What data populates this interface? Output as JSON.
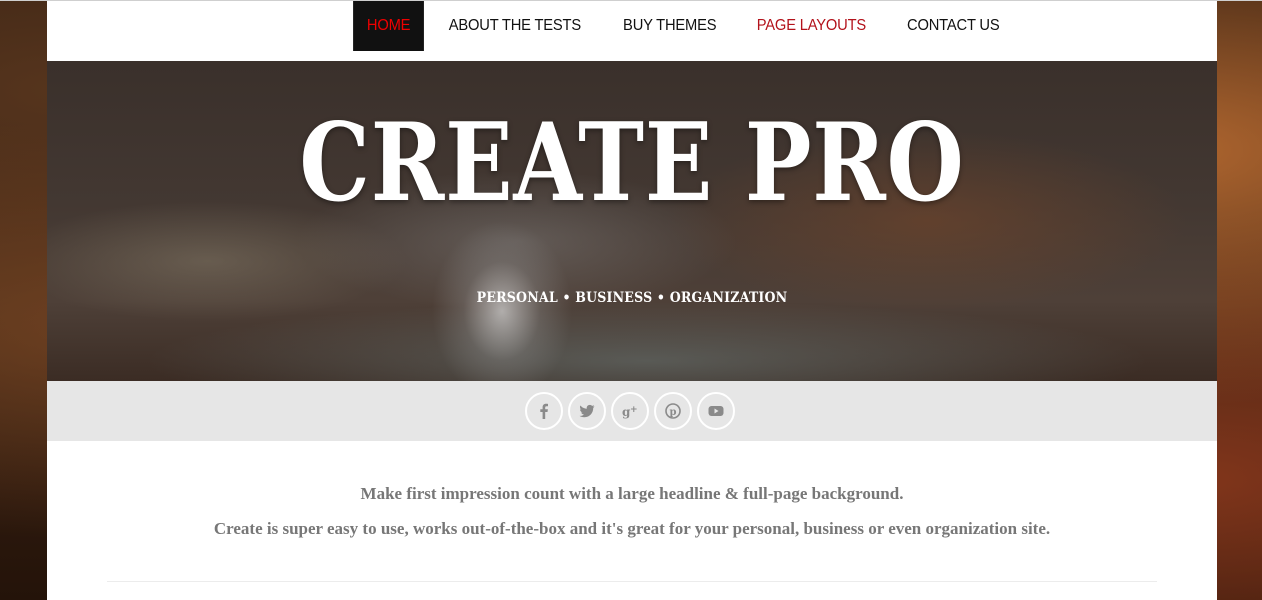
{
  "nav": {
    "items": [
      {
        "label": "HOME"
      },
      {
        "label": "ABOUT THE TESTS"
      },
      {
        "label": "BUY THEMES"
      },
      {
        "label": "PAGE LAYOUTS"
      },
      {
        "label": "CONTACT US"
      }
    ],
    "active_index": 0
  },
  "hero": {
    "title": "CREATE PRO",
    "subtitle": "PERSONAL • BUSINESS • ORGANIZATION"
  },
  "social": {
    "icons": [
      "facebook-icon",
      "twitter-icon",
      "google-plus-icon",
      "pinterest-icon",
      "youtube-icon"
    ]
  },
  "intro": {
    "line1": "Make first impression count with a large headline & full-page background.",
    "line2": "Create is super easy to use, works out-of-the-box and it's great for your personal, business or even organization site."
  },
  "colors": {
    "active_nav_text": "#ee0000",
    "accent_nav_text": "#b3121b",
    "social_icon": "#8a8a8a"
  }
}
